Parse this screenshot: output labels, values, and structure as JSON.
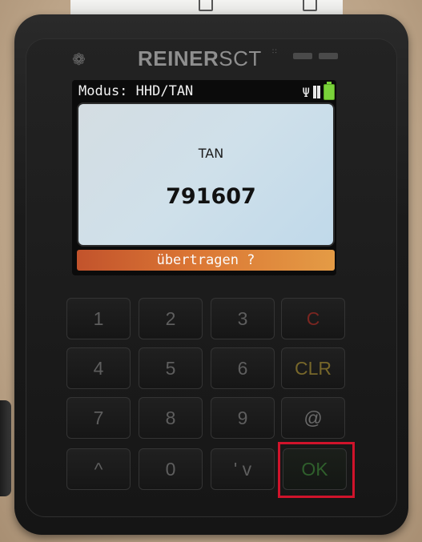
{
  "device": {
    "brand": "REINERSCT",
    "brand_bold_part": "REINER",
    "brand_light_part": "SCT"
  },
  "screen": {
    "mode_label": "Modus: HHD/TAN",
    "tan_label": "TAN",
    "tan_value": "791607",
    "confirm_prompt": "übertragen ?"
  },
  "keypad": {
    "keys": [
      "1",
      "2",
      "3",
      "C",
      "4",
      "5",
      "6",
      "CLR",
      "7",
      "8",
      "9",
      "@",
      "^",
      "0",
      "' v",
      "OK"
    ]
  },
  "colors": {
    "battery": "#7ad33a",
    "confirm_bar_start": "#c2532c",
    "confirm_bar_end": "#e49b45",
    "highlight": "#d0132b",
    "key_c": "#7a2621",
    "key_clr": "#77672a",
    "key_ok": "#2f5f2c"
  }
}
